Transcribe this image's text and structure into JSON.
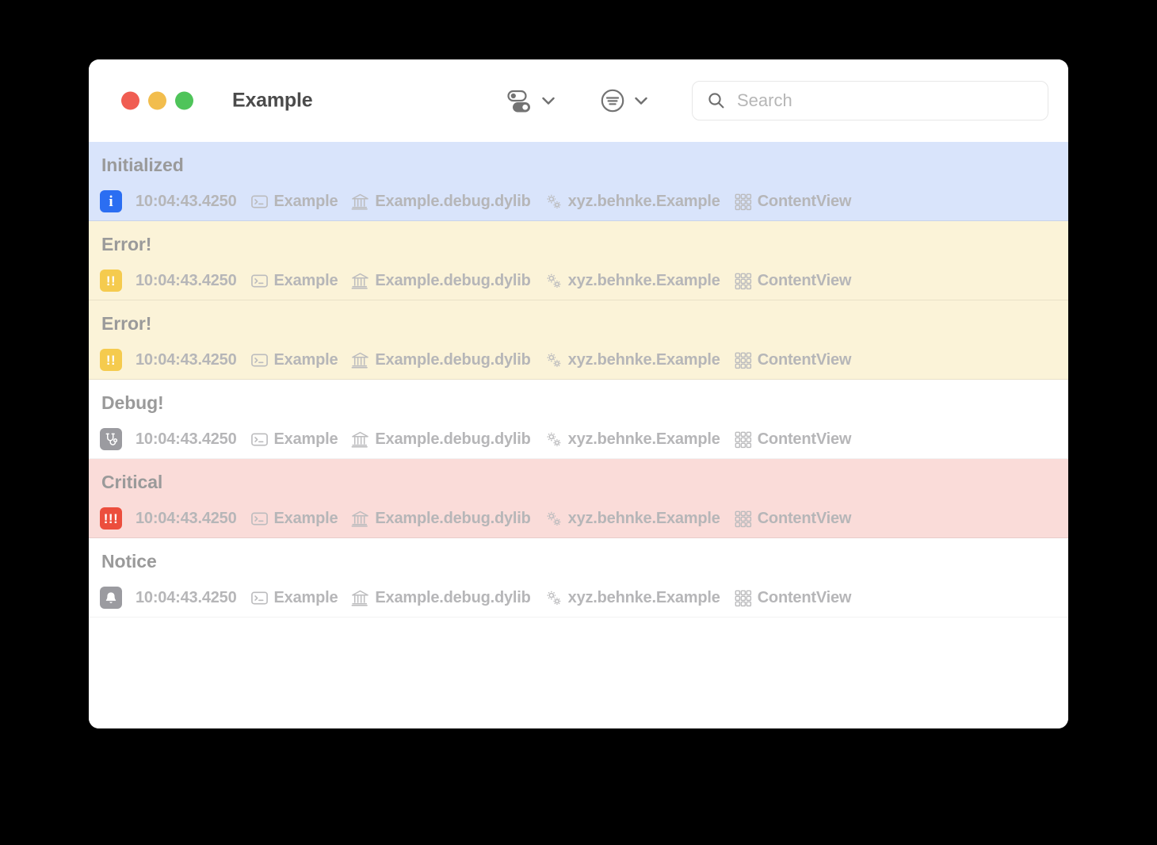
{
  "window": {
    "title": "Example",
    "traffic_lights": [
      {
        "name": "close",
        "color": "#f05d52"
      },
      {
        "name": "minimize",
        "color": "#f2bd4d"
      },
      {
        "name": "maximize",
        "color": "#4fc45a"
      }
    ]
  },
  "toolbar": {
    "filter_toggles": {
      "icon": "switch-toggles-icon",
      "chevron": "chevron-down-icon"
    },
    "sort_menu": {
      "icon": "text-lines-circle-icon",
      "chevron": "chevron-down-icon"
    },
    "search": {
      "icon": "search-icon",
      "placeholder": "Search",
      "value": ""
    }
  },
  "log": {
    "columns": [
      "level",
      "timestamp",
      "process",
      "library",
      "subsystem",
      "category"
    ],
    "column_icons": {
      "process": "terminal-icon",
      "library": "bank-building-icon",
      "subsystem": "gears-icon",
      "category": "grid-squares-icon"
    },
    "rows": [
      {
        "message": "Initialized",
        "level": "info",
        "badge_glyph": "i",
        "badge_color": "#2b6ef2",
        "row_color": "#d9e4fb",
        "timestamp": "10:04:43.4250",
        "process": "Example",
        "library": "Example.debug.dylib",
        "subsystem": "xyz.behnke.Example",
        "category": "ContentView"
      },
      {
        "message": "Error!",
        "level": "error",
        "badge_glyph": "!!",
        "badge_color": "#f5cb4e",
        "row_color": "#fbf3d8",
        "timestamp": "10:04:43.4250",
        "process": "Example",
        "library": "Example.debug.dylib",
        "subsystem": "xyz.behnke.Example",
        "category": "ContentView"
      },
      {
        "message": "Error!",
        "level": "error",
        "badge_glyph": "!!",
        "badge_color": "#f5cb4e",
        "row_color": "#fbf3d8",
        "timestamp": "10:04:43.4250",
        "process": "Example",
        "library": "Example.debug.dylib",
        "subsystem": "xyz.behnke.Example",
        "category": "ContentView"
      },
      {
        "message": "Debug!",
        "level": "debug",
        "badge_glyph": "stethoscope-icon",
        "badge_color": "#9b9ba0",
        "row_color": "#ffffff",
        "timestamp": "10:04:43.4250",
        "process": "Example",
        "library": "Example.debug.dylib",
        "subsystem": "xyz.behnke.Example",
        "category": "ContentView"
      },
      {
        "message": "Critical",
        "level": "critical",
        "badge_glyph": "!!!",
        "badge_color": "#ec4e3d",
        "row_color": "#fadcd9",
        "timestamp": "10:04:43.4250",
        "process": "Example",
        "library": "Example.debug.dylib",
        "subsystem": "xyz.behnke.Example",
        "category": "ContentView"
      },
      {
        "message": "Notice",
        "level": "notice",
        "badge_glyph": "bell-icon",
        "badge_color": "#9b9ba0",
        "row_color": "#ffffff",
        "timestamp": "10:04:43.4250",
        "process": "Example",
        "library": "Example.debug.dylib",
        "subsystem": "xyz.behnke.Example",
        "category": "ContentView"
      }
    ]
  }
}
